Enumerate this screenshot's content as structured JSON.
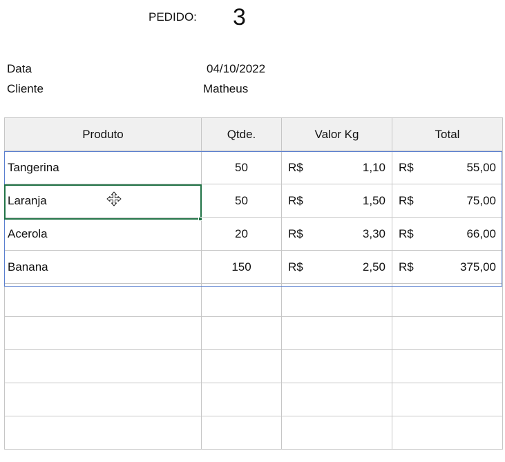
{
  "header": {
    "pedido_label": "PEDIDO:",
    "pedido_number": "3"
  },
  "meta": {
    "date_label": "Data",
    "date_value": "04/10/2022",
    "client_label": "Cliente",
    "client_value": "Matheus"
  },
  "table": {
    "columns": [
      "Produto",
      "Qtde.",
      "Valor Kg",
      "Total"
    ],
    "currency": "R$",
    "rows": [
      {
        "produto": "Tangerina",
        "qtde": "50",
        "valor": "1,10",
        "total": "55,00"
      },
      {
        "produto": "Laranja",
        "qtde": "50",
        "valor": "1,50",
        "total": "75,00"
      },
      {
        "produto": "Acerola",
        "qtde": "20",
        "valor": "3,30",
        "total": "66,00"
      },
      {
        "produto": "Banana",
        "qtde": "150",
        "valor": "2,50",
        "total": "375,00"
      }
    ],
    "empty_rows": 5
  },
  "selection": {
    "cell_value": "Laranja",
    "cursor_icon": "move-cursor-icon"
  },
  "colors": {
    "selection_border": "#217346",
    "table_range_border": "#5a7fcf",
    "header_fill": "#f0f0f0",
    "grid_line": "#c6c6c6"
  }
}
